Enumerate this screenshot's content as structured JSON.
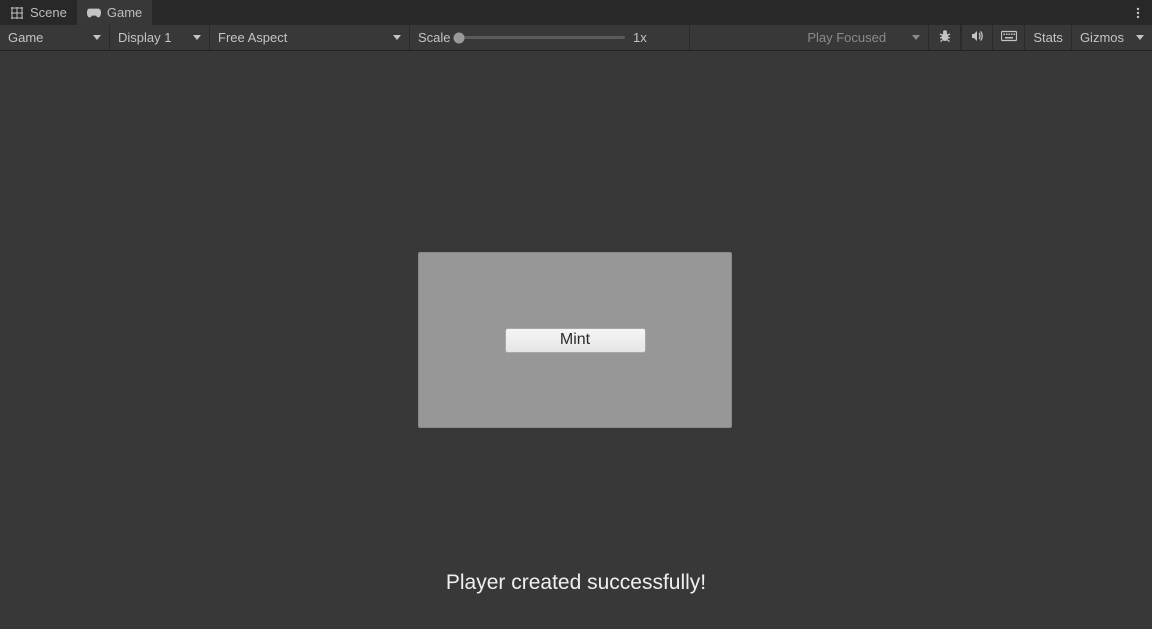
{
  "tabs": {
    "scene": {
      "label": "Scene",
      "active": false
    },
    "game": {
      "label": "Game",
      "active": true
    }
  },
  "toolbar": {
    "camera_dd": "Game",
    "display_dd": "Display 1",
    "aspect_dd": "Free Aspect",
    "scale_label": "Scale",
    "scale_value": "1x",
    "playfocus_dd": "Play Focused",
    "stats": "Stats",
    "gizmos": "Gizmos"
  },
  "gameview": {
    "button_label": "Mint",
    "status_text": "Player created successfully!"
  }
}
